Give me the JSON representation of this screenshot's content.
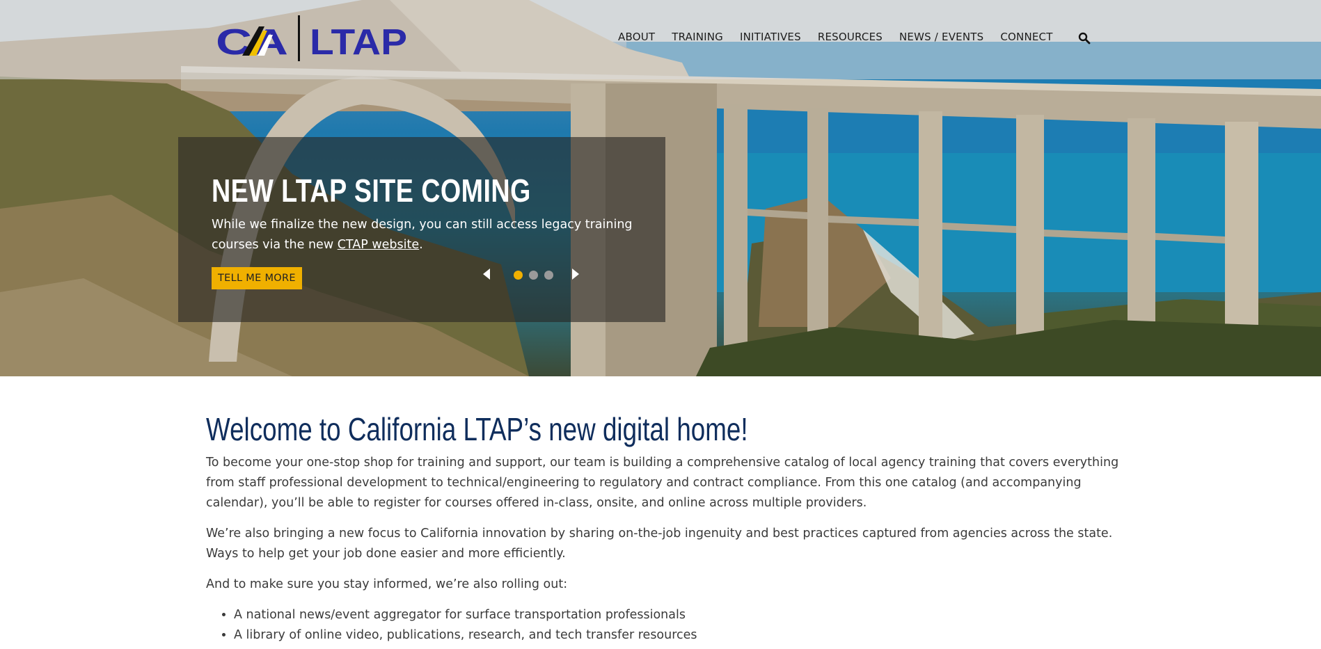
{
  "header": {
    "logo_left": "CA",
    "logo_right": "LTAP",
    "nav": [
      "ABOUT",
      "TRAINING",
      "INITIATIVES",
      "RESOURCES",
      "NEWS / EVENTS",
      "CONNECT"
    ],
    "search_icon": "search-icon"
  },
  "hero": {
    "title": "NEW LTAP SITE COMING",
    "text_before_link": "While we finalize the new design, you can still access legacy training courses via the new ",
    "link_text": "CTAP website",
    "text_after_link": ".",
    "button_label": "TELL ME MORE",
    "slide_count": 3,
    "active_slide": 1,
    "accent_color": "#f0b000"
  },
  "main": {
    "heading": "Welcome to California LTAP’s new digital home!",
    "paragraph1": "To become your one-stop shop for training and support, our team is building a comprehensive catalog of local agency training that covers everything from staff professional development to technical/engineering to regulatory and contract compliance. From this one catalog (and accompanying calendar), you’ll be able to register for courses offered in-class, onsite, and online across multiple providers.",
    "paragraph2": "We’re also bringing a new focus to California innovation by sharing on-the-job ingenuity and best practices captured from agencies across the state. Ways to help get your job done easier and more efficiently.",
    "paragraph3": "And to make sure you stay informed, we’re also rolling out:",
    "bullets": [
      "A national news/event aggregator for surface transportation professionals",
      "A library of online video, publications, research, and tech transfer resources"
    ],
    "heading_color": "#0f2d5c"
  }
}
